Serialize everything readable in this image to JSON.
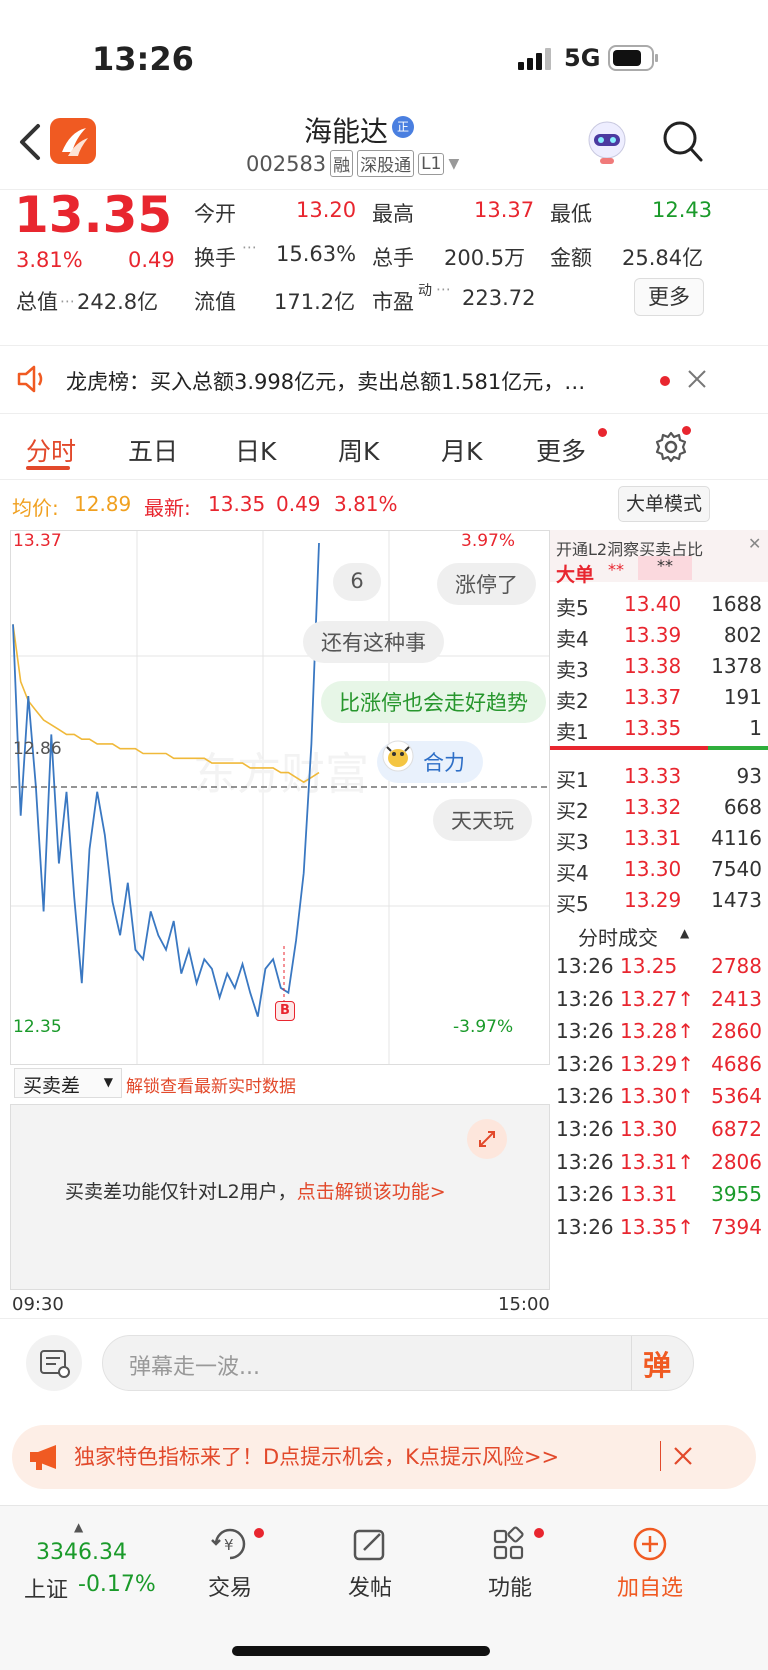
{
  "status": {
    "time": "13:26",
    "network": "5G"
  },
  "header": {
    "title": "海能达",
    "badge": "正",
    "code": "002583",
    "tags": [
      "融",
      "深股通",
      "L1"
    ]
  },
  "quote": {
    "price": "13.35",
    "pct": "3.81%",
    "change": "0.49",
    "open_label": "今开",
    "open": "13.20",
    "high_label": "最高",
    "high": "13.37",
    "low_label": "最低",
    "low": "12.43",
    "turnover_label": "换手",
    "turnover": "15.63%",
    "volume_label": "总手",
    "volume": "200.5万",
    "amount_label": "金额",
    "amount": "25.84亿",
    "mktcap_label": "总值",
    "mktcap": "242.8亿",
    "float_label": "流值",
    "float": "171.2亿",
    "pe_label": "市盈",
    "pe_sup": "动",
    "pe": "223.72",
    "more_button": "更多"
  },
  "notice": {
    "text": "龙虎榜：买入总额3.998亿元，卖出总额1.581亿元，…"
  },
  "tabs": [
    "分时",
    "五日",
    "日K",
    "周K",
    "月K",
    "更多"
  ],
  "active_tab": 0,
  "pricebar": {
    "avg_label": "均价:",
    "avg": "12.89",
    "latest_label": "最新:",
    "latest": "13.35",
    "change": "0.49",
    "pct": "3.81%",
    "mode_button": "大单模式"
  },
  "chart": {
    "y_top": "13.37",
    "y_mid": "12.86",
    "y_bottom": "12.35",
    "pct_top": "3.97%",
    "pct_bottom": "-3.97%",
    "watermark": "东方财富",
    "marker": "B",
    "bubbles": [
      "6",
      "涨停了",
      "还有这种事",
      "比涨停也会走好趋势",
      "合力",
      "天天玩"
    ],
    "time_start": "09:30",
    "time_end": "15:00",
    "colors": {
      "price": "#3a78c2",
      "avg": "#f0b93a",
      "up": "#e8262f",
      "down": "#1a9a2a"
    }
  },
  "chart_data": {
    "type": "line",
    "title": "",
    "ylim": [
      12.35,
      13.37
    ],
    "y_ref": 12.86,
    "series": [
      {
        "name": "price",
        "values": [
          13.2,
          12.8,
          13.05,
          12.86,
          12.6,
          12.97,
          12.7,
          12.85,
          12.63,
          12.45,
          12.73,
          12.85,
          12.76,
          12.62,
          12.55,
          12.66,
          12.52,
          12.5,
          12.6,
          12.55,
          12.52,
          12.58,
          12.47,
          12.52,
          12.45,
          12.5,
          12.48,
          12.42,
          12.47,
          12.44,
          12.49,
          12.43,
          12.38,
          12.48,
          12.5,
          12.44,
          12.43,
          12.54,
          12.68,
          12.95,
          13.37
        ]
      },
      {
        "name": "avg",
        "values": [
          13.2,
          13.08,
          13.04,
          13.02,
          13.0,
          12.99,
          12.98,
          12.97,
          12.97,
          12.96,
          12.96,
          12.95,
          12.95,
          12.95,
          12.94,
          12.94,
          12.94,
          12.93,
          12.93,
          12.93,
          12.93,
          12.92,
          12.92,
          12.92,
          12.92,
          12.92,
          12.91,
          12.91,
          12.91,
          12.91,
          12.91,
          12.9,
          12.9,
          12.9,
          12.9,
          12.89,
          12.89,
          12.88,
          12.87,
          12.88,
          12.89
        ]
      }
    ]
  },
  "orderbook": {
    "l2_hint": "开通L2洞察买卖占比",
    "big_label": "大单",
    "big_value": "**",
    "big_value2": "**",
    "asks": [
      {
        "label": "卖5",
        "price": "13.40",
        "vol": "1688"
      },
      {
        "label": "卖4",
        "price": "13.39",
        "vol": "802"
      },
      {
        "label": "卖3",
        "price": "13.38",
        "vol": "1378"
      },
      {
        "label": "卖2",
        "price": "13.37",
        "vol": "191"
      },
      {
        "label": "卖1",
        "price": "13.35",
        "vol": "1"
      }
    ],
    "bids": [
      {
        "label": "买1",
        "price": "13.33",
        "vol": "93"
      },
      {
        "label": "买2",
        "price": "13.32",
        "vol": "668"
      },
      {
        "label": "买3",
        "price": "13.31",
        "vol": "4116"
      },
      {
        "label": "买4",
        "price": "13.30",
        "vol": "7540"
      },
      {
        "label": "买5",
        "price": "13.29",
        "vol": "1473"
      }
    ],
    "ticks_title": "分时成交",
    "ticks": [
      {
        "time": "13:26",
        "price": "13.25",
        "vol": "2788",
        "up": false,
        "vol_color": "red"
      },
      {
        "time": "13:26",
        "price": "13.27↑",
        "vol": "2413",
        "up": true,
        "vol_color": "red"
      },
      {
        "time": "13:26",
        "price": "13.28↑",
        "vol": "2860",
        "up": true,
        "vol_color": "red"
      },
      {
        "time": "13:26",
        "price": "13.29↑",
        "vol": "4686",
        "up": true,
        "vol_color": "red"
      },
      {
        "time": "13:26",
        "price": "13.30↑",
        "vol": "5364",
        "up": true,
        "vol_color": "red"
      },
      {
        "time": "13:26",
        "price": "13.30",
        "vol": "6872",
        "up": false,
        "vol_color": "red"
      },
      {
        "time": "13:26",
        "price": "13.31↑",
        "vol": "2806",
        "up": true,
        "vol_color": "red"
      },
      {
        "time": "13:26",
        "price": "13.31",
        "vol": "3955",
        "up": false,
        "vol_color": "green"
      },
      {
        "time": "13:26",
        "price": "13.35↑",
        "vol": "7394",
        "up": true,
        "vol_color": "red"
      }
    ]
  },
  "subchart": {
    "select": "买卖差",
    "unlock_text": "解锁查看最新实时数据",
    "info_text": "买卖差功能仅针对L2用户，",
    "info_link": "点击解锁该功能>"
  },
  "danmu": {
    "placeholder": "弹幕走一波...",
    "button": "弹"
  },
  "promo": {
    "text": "独家特色指标来了！D点提示机会，K点提示风险>>"
  },
  "tabbar": {
    "index_value": "3346.34",
    "index_name": "上证",
    "index_change": "-0.17%",
    "items": [
      "交易",
      "发帖",
      "功能",
      "加自选"
    ]
  }
}
